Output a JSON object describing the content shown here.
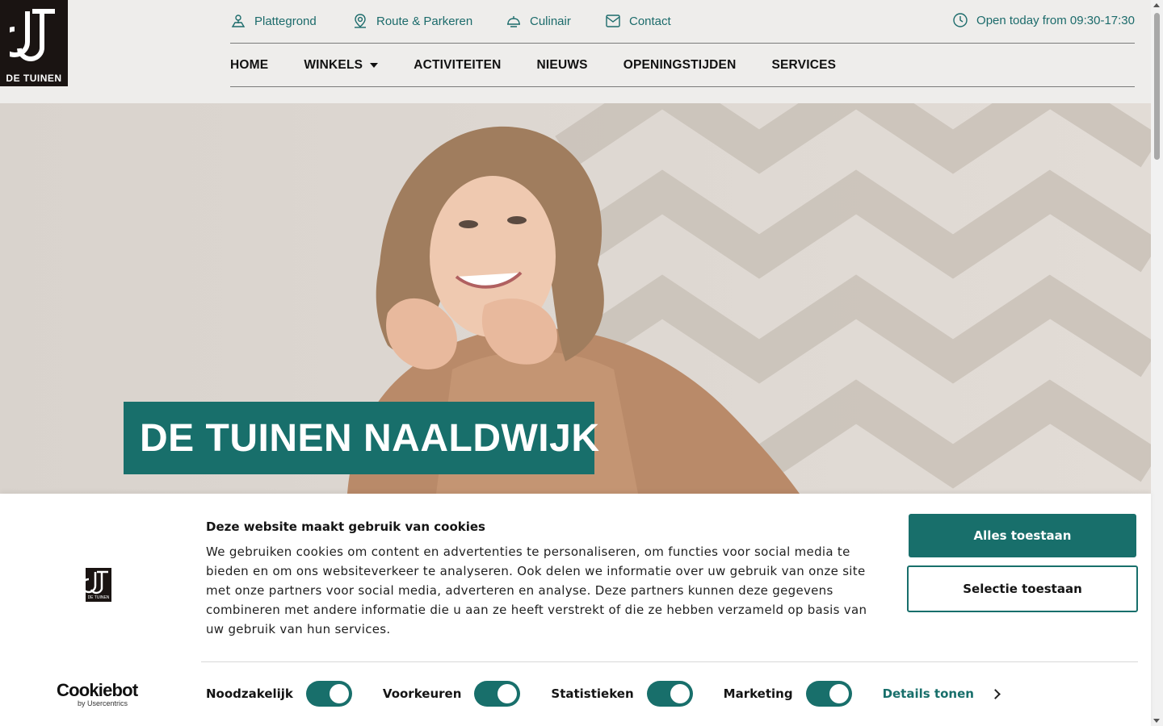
{
  "brand": {
    "logo_text": "DE TUINEN"
  },
  "topbar": {
    "links": [
      {
        "label": "Plattegrond",
        "icon": "map-icon"
      },
      {
        "label": "Route & Parkeren",
        "icon": "location-pin-icon"
      },
      {
        "label": "Culinair",
        "icon": "food-icon"
      },
      {
        "label": "Contact",
        "icon": "mail-icon"
      }
    ],
    "open_hours": "Open today from 09:30-17:30"
  },
  "nav": {
    "items": [
      "HOME",
      "WINKELS",
      "ACTIVITEITEN",
      "NIEUWS",
      "OPENINGSTIJDEN",
      "SERVICES"
    ]
  },
  "hero": {
    "title": "DE TUINEN NAALDWIJK"
  },
  "cookie": {
    "title": "Deze website maakt gebruik van cookies",
    "body": "We gebruiken cookies om content en advertenties te personaliseren, om functies voor social media te bieden en om ons websiteverkeer te analyseren. Ook delen we informatie over uw gebruik van onze site met onze partners voor social media, adverteren en analyse. Deze partners kunnen deze gegevens combineren met andere informatie die u aan ze heeft verstrekt of die ze hebben verzameld op basis van uw gebruik van hun services.",
    "allow_all": "Alles toestaan",
    "allow_selection": "Selectie toestaan",
    "toggles": [
      {
        "label": "Noodzakelijk",
        "on": true
      },
      {
        "label": "Voorkeuren",
        "on": true
      },
      {
        "label": "Statistieken",
        "on": true
      },
      {
        "label": "Marketing",
        "on": true
      }
    ],
    "details": "Details tonen",
    "provider_main": "Cookiebot",
    "provider_sub": "by Usercentrics",
    "logo_small_text": "DE TUINEN"
  },
  "colors": {
    "accent": "#186f6b",
    "link": "#1c6b6b",
    "logo_bg": "#1a1412"
  }
}
